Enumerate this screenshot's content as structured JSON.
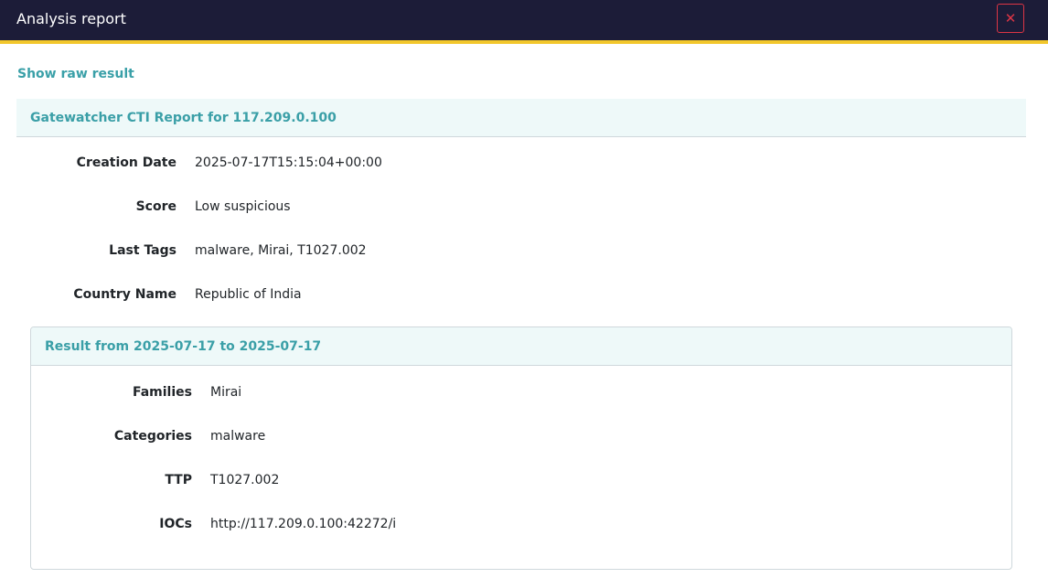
{
  "header": {
    "title": "Analysis report",
    "close_symbol": "✕"
  },
  "raw_link": "Show raw result",
  "report": {
    "title": "Gatewatcher CTI Report for 117.209.0.100",
    "fields": [
      {
        "label": "Creation Date",
        "value": "2025-07-17T15:15:04+00:00"
      },
      {
        "label": "Score",
        "value": "Low suspicious"
      },
      {
        "label": "Last Tags",
        "value": "malware, Mirai, T1027.002"
      },
      {
        "label": "Country Name",
        "value": "Republic of India"
      }
    ]
  },
  "result": {
    "title": "Result from 2025-07-17 to 2025-07-17",
    "fields": [
      {
        "label": "Families",
        "value": "Mirai"
      },
      {
        "label": "Categories",
        "value": "malware"
      },
      {
        "label": "TTP",
        "value": "T1027.002"
      },
      {
        "label": "IOCs",
        "value": "http://117.209.0.100:42272/i"
      }
    ]
  },
  "colors": {
    "header_bg": "#1c1c38",
    "header_accent": "#f2c72c",
    "link": "#3aa0a8",
    "section_bg": "#eef9f9",
    "danger": "#dc3545"
  }
}
